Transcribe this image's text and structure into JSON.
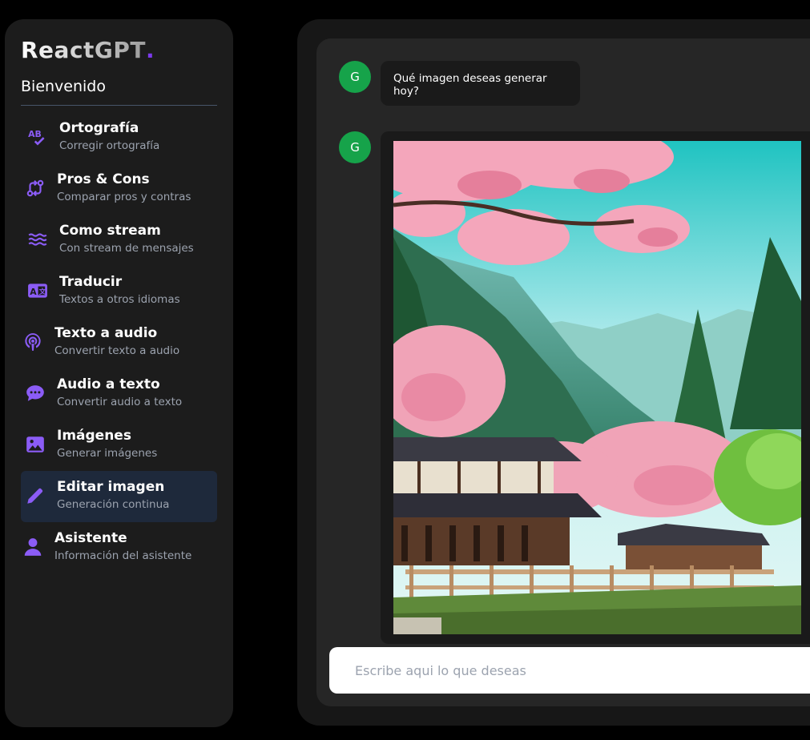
{
  "brand": {
    "name": "ReactGPT",
    "dot": "."
  },
  "sidebar": {
    "welcome": "Bienvenido",
    "items": [
      {
        "title": "Ortografía",
        "subtitle": "Corregir ortografía",
        "icon": "spell-check-icon"
      },
      {
        "title": "Pros & Cons",
        "subtitle": "Comparar pros y contras",
        "icon": "code-compare-icon"
      },
      {
        "title": "Como stream",
        "subtitle": "Con stream de mensajes",
        "icon": "water-icon"
      },
      {
        "title": "Traducir",
        "subtitle": "Textos a otros idiomas",
        "icon": "language-icon"
      },
      {
        "title": "Texto a audio",
        "subtitle": "Convertir texto a audio",
        "icon": "podcast-icon"
      },
      {
        "title": "Audio a texto",
        "subtitle": "Convertir audio a texto",
        "icon": "comment-dots-icon"
      },
      {
        "title": "Imágenes",
        "subtitle": "Generar imágenes",
        "icon": "image-icon"
      },
      {
        "title": "Editar imagen",
        "subtitle": "Generación continua",
        "icon": "pencil-icon",
        "active": true
      },
      {
        "title": "Asistente",
        "subtitle": "Información del asistente",
        "icon": "user-icon"
      }
    ]
  },
  "chat": {
    "messages": [
      {
        "avatar": "G",
        "text": "Qué imagen deseas generar hoy?"
      },
      {
        "avatar": "G",
        "image": "Cherry blossom landscape with Japanese temple and mountains"
      }
    ],
    "input": {
      "placeholder": "Escribe aqui lo que deseas",
      "value": ""
    }
  },
  "colors": {
    "accent": "#8b5cf6",
    "avatar": "#16a34a",
    "active_bg": "#1e293b"
  }
}
